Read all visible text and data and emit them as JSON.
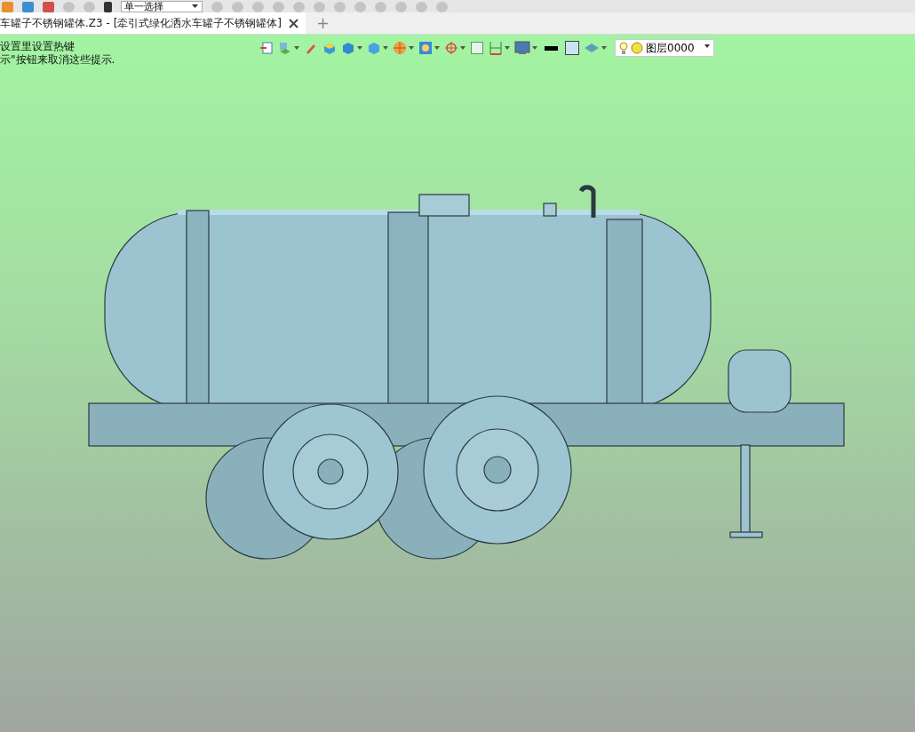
{
  "toolbar": {
    "selection_filter": "单一选择"
  },
  "tabs": [
    {
      "label": "车罐子不锈钢罐体.Z3 - [牵引式绿化洒水车罐子不锈钢罐体]",
      "selected": true
    }
  ],
  "new_tab": "+",
  "hints": [
    "设置里设置热键",
    "示\"按钮来取消这些提示."
  ],
  "view_toolbar": {
    "layer": "图层0000"
  }
}
